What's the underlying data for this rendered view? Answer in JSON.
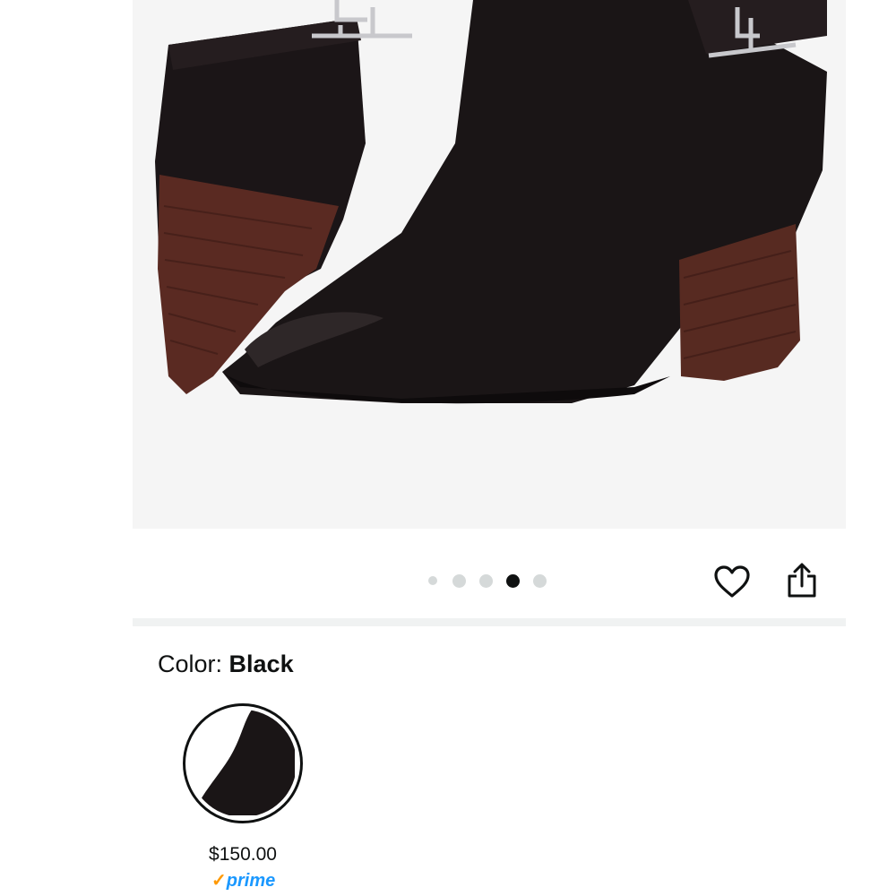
{
  "product": {
    "image_alt": "black suede ankle boot with stacked wooden heel",
    "carousel": {
      "total": 5,
      "active_index": 3
    }
  },
  "actions": {
    "wishlist_icon": "heart-icon",
    "share_icon": "share-icon"
  },
  "color_selector": {
    "label": "Color: ",
    "value": "Black",
    "swatch": {
      "price": "$150.00",
      "prime_check": "✓",
      "prime_label": "prime"
    }
  },
  "colors": {
    "background": "#ffffff",
    "image_bg": "#f5f5f5",
    "dot_inactive": "#d5d9d9",
    "dot_active": "#0f1111",
    "prime_blue": "#1a98ff",
    "prime_check": "#ff9900"
  }
}
